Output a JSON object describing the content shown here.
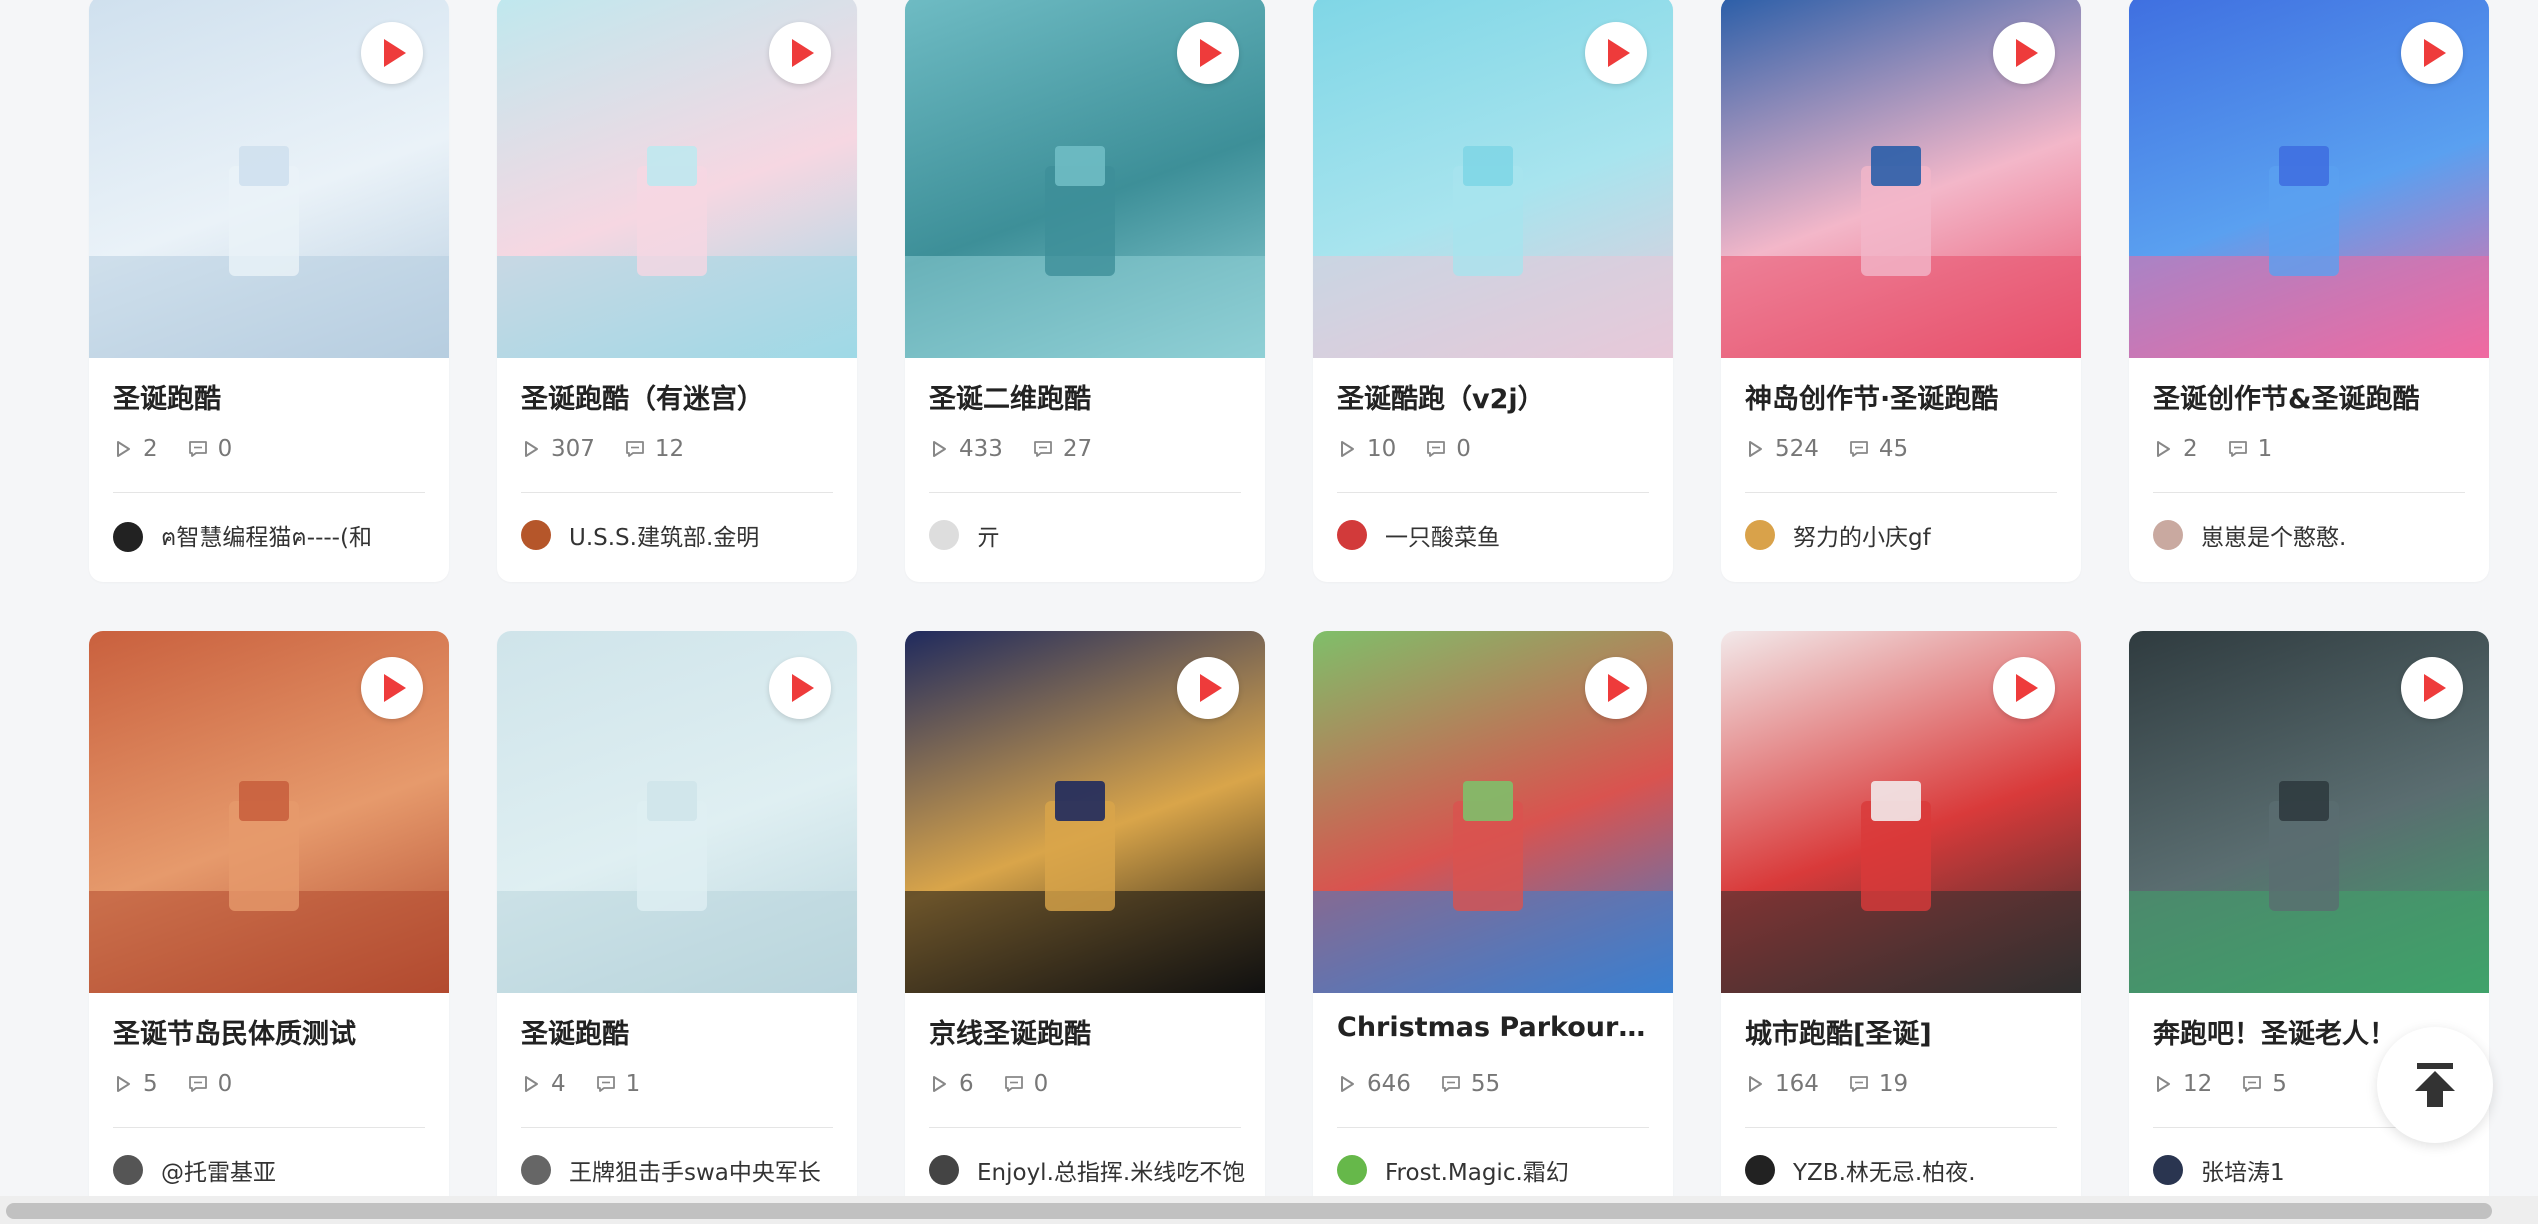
{
  "colors": {
    "accent": "#ee3b3b",
    "page_bg": "#f5f6f8",
    "card_bg": "#ffffff"
  },
  "cards": [
    {
      "title": "圣诞跑酷",
      "plays": "2",
      "comments": "0",
      "author": "ฅ智慧编程猫ฅ----(和",
      "thumb": [
        "#cfe0ee",
        "#eaf2f8",
        "#b7cde0"
      ],
      "avatar": "#222222"
    },
    {
      "title": "圣诞跑酷（有迷宫）",
      "plays": "307",
      "comments": "12",
      "author": "U.S.S.建筑部.金明",
      "thumb": [
        "#bfe8ee",
        "#f6d7e2",
        "#9fd9e6"
      ],
      "avatar": "#b5562a"
    },
    {
      "title": "圣诞二维跑酷",
      "plays": "433",
      "comments": "27",
      "author": "亓",
      "thumb": [
        "#6fbcc4",
        "#3d8f98",
        "#8fd0d6"
      ],
      "avatar": "#dddddd"
    },
    {
      "title": "圣诞酷跑（v2j）",
      "plays": "10",
      "comments": "0",
      "author": "一只酸菜鱼",
      "thumb": [
        "#7fd6e6",
        "#a8e4ee",
        "#e8c9d9"
      ],
      "avatar": "#d23a3a"
    },
    {
      "title": "神岛创作节·圣诞跑酷",
      "plays": "524",
      "comments": "45",
      "author": "努力的小庆gf",
      "thumb": [
        "#2a5ea8",
        "#f3b7c9",
        "#e84f6a"
      ],
      "avatar": "#d9a24a"
    },
    {
      "title": "圣诞创作节&圣诞跑酷",
      "plays": "2",
      "comments": "1",
      "author": "崽崽是个憨憨.",
      "thumb": [
        "#3f6fe0",
        "#5aa0f0",
        "#f06aa0"
      ],
      "avatar": "#c9a9a0"
    },
    {
      "title": "圣诞节岛民体质测试",
      "plays": "5",
      "comments": "0",
      "author": "@托雷基亚",
      "thumb": [
        "#c9603e",
        "#e69a6c",
        "#b24a30"
      ],
      "avatar": "#555555"
    },
    {
      "title": "圣诞跑酷",
      "plays": "4",
      "comments": "1",
      "author": "王牌狙击手swa中央军长",
      "thumb": [
        "#cfe4ea",
        "#dfeff2",
        "#b9d5dd"
      ],
      "avatar": "#666666"
    },
    {
      "title": "京线圣诞跑酷",
      "plays": "6",
      "comments": "0",
      "author": "Enjoyl.总指挥.米线吃不饱",
      "thumb": [
        "#1f2a5e",
        "#d9a54a",
        "#111111"
      ],
      "avatar": "#444444"
    },
    {
      "title": "Christmas Parkour/...",
      "plays": "646",
      "comments": "55",
      "author": "Frost.Magic.霜幻",
      "thumb": [
        "#7fbf6a",
        "#d9534f",
        "#3a7fd0"
      ],
      "avatar": "#66b84a"
    },
    {
      "title": "城市跑酷[圣诞]",
      "plays": "164",
      "comments": "19",
      "author": "YZB.林无忌.柏夜.",
      "thumb": [
        "#f2e9ea",
        "#d93a3a",
        "#2f2f2f"
      ],
      "avatar": "#222222"
    },
    {
      "title": "奔跑吧！圣诞老人！",
      "plays": "12",
      "comments": "5",
      "author": "张培涛1",
      "thumb": [
        "#2f3b3f",
        "#5a6d70",
        "#3fa36a"
      ],
      "avatar": "#2a3550"
    }
  ],
  "icons": {
    "play": "play-icon",
    "views": "views-icon",
    "comments": "comment-icon",
    "back_top": "back-to-top-icon"
  }
}
